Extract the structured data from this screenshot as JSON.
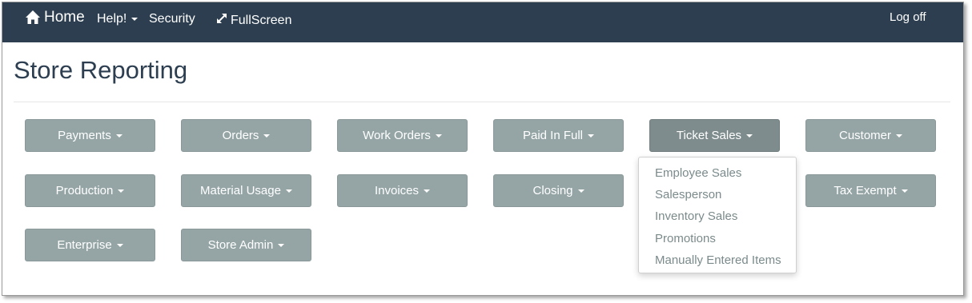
{
  "navbar": {
    "home_label": "Home",
    "help_label": "Help!",
    "security_label": "Security",
    "fullscreen_label": "FullScreen",
    "logoff_label": "Log off"
  },
  "page": {
    "title": "Store Reporting"
  },
  "report_buttons": [
    {
      "label": "Payments"
    },
    {
      "label": "Orders"
    },
    {
      "label": "Work Orders"
    },
    {
      "label": "Paid In Full"
    },
    {
      "label": "Ticket Sales"
    },
    {
      "label": "Customer"
    },
    {
      "label": "Production"
    },
    {
      "label": "Material Usage"
    },
    {
      "label": "Invoices"
    },
    {
      "label": "Closing"
    },
    {
      "label": "Tax Exempt"
    },
    {
      "label": "Enterprise"
    },
    {
      "label": "Store Admin"
    }
  ],
  "ticket_sales_menu": {
    "items": [
      {
        "label": "Employee Sales"
      },
      {
        "label": "Salesperson"
      },
      {
        "label": "Inventory Sales"
      },
      {
        "label": "Promotions"
      },
      {
        "label": "Manually Entered Items"
      }
    ]
  },
  "colors": {
    "navbar_bg": "#2c3e50",
    "button_bg": "#95a5a6",
    "button_active_bg": "#7f8c8d",
    "title_color": "#2c3e50",
    "menu_text": "#7b8a8b"
  },
  "icons": {
    "home": "home-icon",
    "caret": "caret-down-icon",
    "fullscreen": "expand-arrows-icon"
  }
}
